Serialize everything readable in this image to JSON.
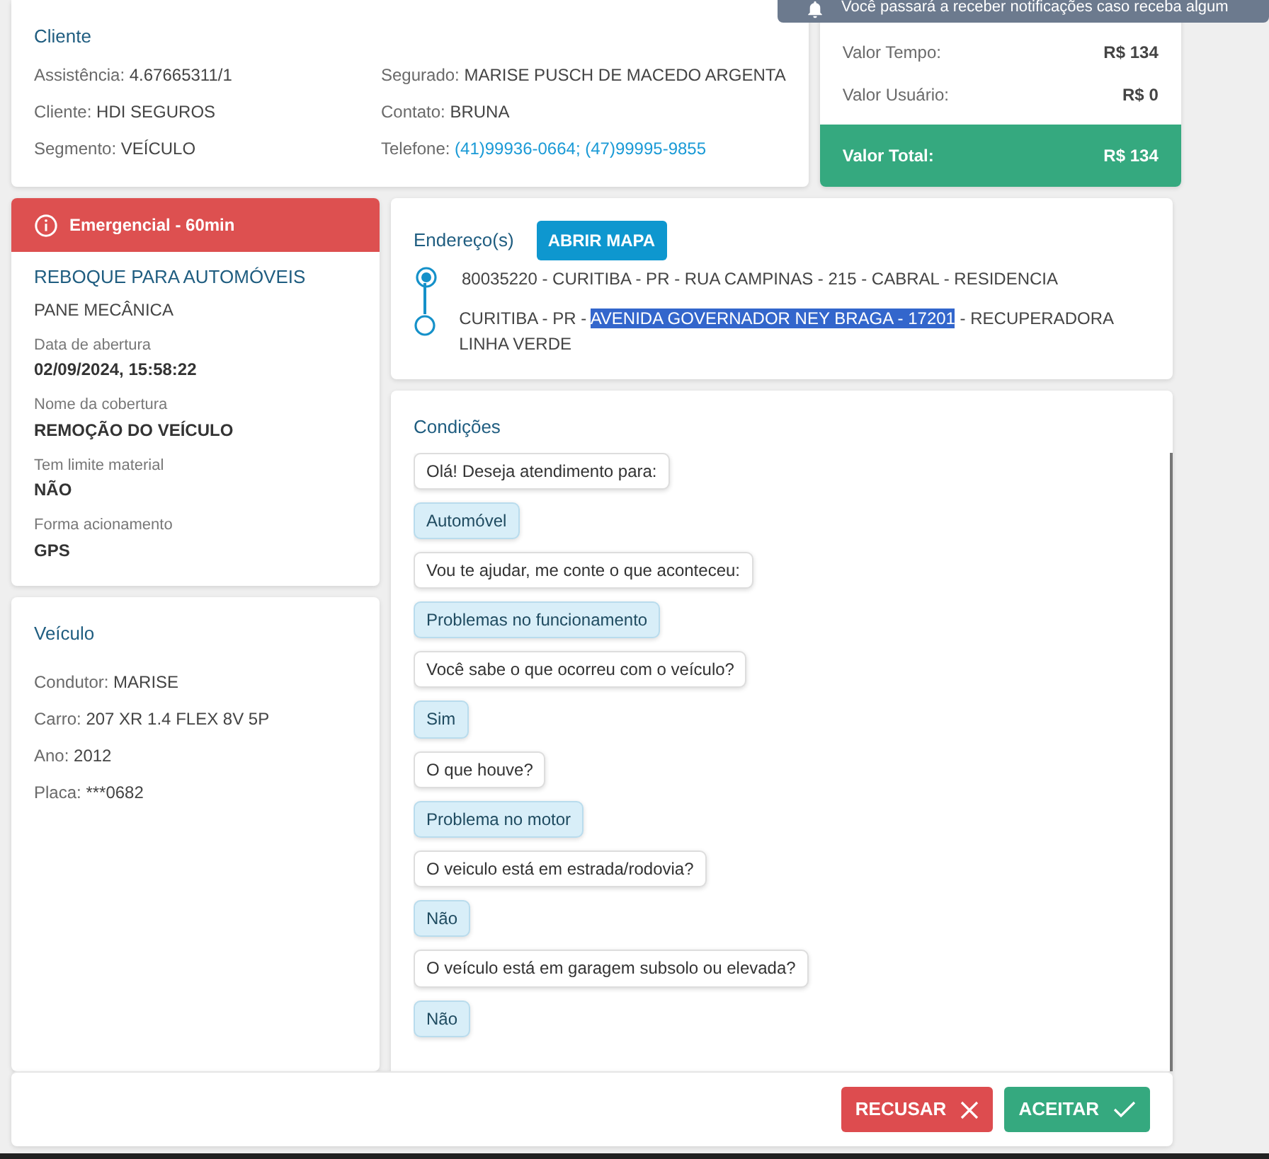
{
  "notification": {
    "text": "Você passará a receber notificações caso receba algum"
  },
  "cliente": {
    "title": "Cliente",
    "fields": [
      {
        "label": "Assistência:",
        "value": "4.67665311/1",
        "kind": "text"
      },
      {
        "label": "Segurado:",
        "value": "MARISE PUSCH DE MACEDO ARGENTA",
        "kind": "text"
      },
      {
        "label": "Cliente:",
        "value": "HDI SEGUROS",
        "kind": "text"
      },
      {
        "label": "Contato:",
        "value": "BRUNA",
        "kind": "text"
      },
      {
        "label": "Segmento:",
        "value": "VEÍCULO",
        "kind": "text"
      },
      {
        "label": "Telefone:",
        "value": "(41)99936-0664; (47)99995-9855",
        "kind": "link"
      }
    ]
  },
  "valores": [
    {
      "label": "Valor Tempo:",
      "value": "R$ 134",
      "kind": "normal"
    },
    {
      "label": "Valor Usuário:",
      "value": "R$ 0",
      "kind": "normal"
    },
    {
      "label": "Valor Total:",
      "value": "R$ 134",
      "kind": "total"
    }
  ],
  "servico": {
    "badge": "Emergencial - 60min",
    "title": "REBOQUE PARA AUTOMÓVEIS",
    "subtitle": "PANE MECÂNICA",
    "fields": [
      {
        "label": "Data de abertura",
        "value": "02/09/2024, 15:58:22"
      },
      {
        "label": "Nome da cobertura",
        "value": "REMOÇÃO DO VEÍCULO"
      },
      {
        "label": "Tem limite material",
        "value": "NÃO"
      },
      {
        "label": "Forma acionamento",
        "value": "GPS"
      }
    ]
  },
  "veiculo": {
    "title": "Veículo",
    "fields": [
      {
        "label": "Condutor:",
        "value": "MARISE"
      },
      {
        "label": "Carro:",
        "value": "207 XR 1.4 FLEX 8V 5P"
      },
      {
        "label": "Ano:",
        "value": "2012"
      },
      {
        "label": "Placa:",
        "value": "***0682"
      }
    ]
  },
  "enderecos": {
    "title": "Endereço(s)",
    "button": "ABRIR MAPA",
    "items": [
      {
        "kind": "origin",
        "parts": [
          {
            "text": "80035220 - CURITIBA - PR - RUA CAMPINAS - 215 - CABRAL - RESIDENCIA",
            "selected": false
          }
        ]
      },
      {
        "kind": "destination",
        "parts": [
          {
            "text": "CURITIBA - PR - ",
            "selected": false
          },
          {
            "text": "AVENIDA GOVERNADOR NEY BRAGA - 17201",
            "selected": true
          },
          {
            "text": " - RECUPERADORA LINHA VERDE",
            "selected": false
          }
        ]
      }
    ]
  },
  "condicoes": {
    "title": "Condições",
    "messages": [
      {
        "kind": "question",
        "text": "Olá! Deseja atendimento para:"
      },
      {
        "kind": "answer",
        "text": "Automóvel"
      },
      {
        "kind": "question",
        "text": "Vou te ajudar, me conte o que aconteceu:"
      },
      {
        "kind": "answer",
        "text": "Problemas no funcionamento"
      },
      {
        "kind": "question",
        "text": "Você sabe o que ocorreu com o veículo?"
      },
      {
        "kind": "answer",
        "text": "Sim"
      },
      {
        "kind": "question",
        "text": "O que houve?"
      },
      {
        "kind": "answer",
        "text": "Problema no motor"
      },
      {
        "kind": "question",
        "text": "O veiculo está em estrada/rodovia?"
      },
      {
        "kind": "answer",
        "text": "Não"
      },
      {
        "kind": "question",
        "text": "O veículo está em garagem subsolo ou elevada?"
      },
      {
        "kind": "answer",
        "text": "Não"
      }
    ]
  },
  "actions": [
    {
      "label": "RECUSAR",
      "kind": "reject"
    },
    {
      "label": "ACEITAR",
      "kind": "accept"
    }
  ]
}
